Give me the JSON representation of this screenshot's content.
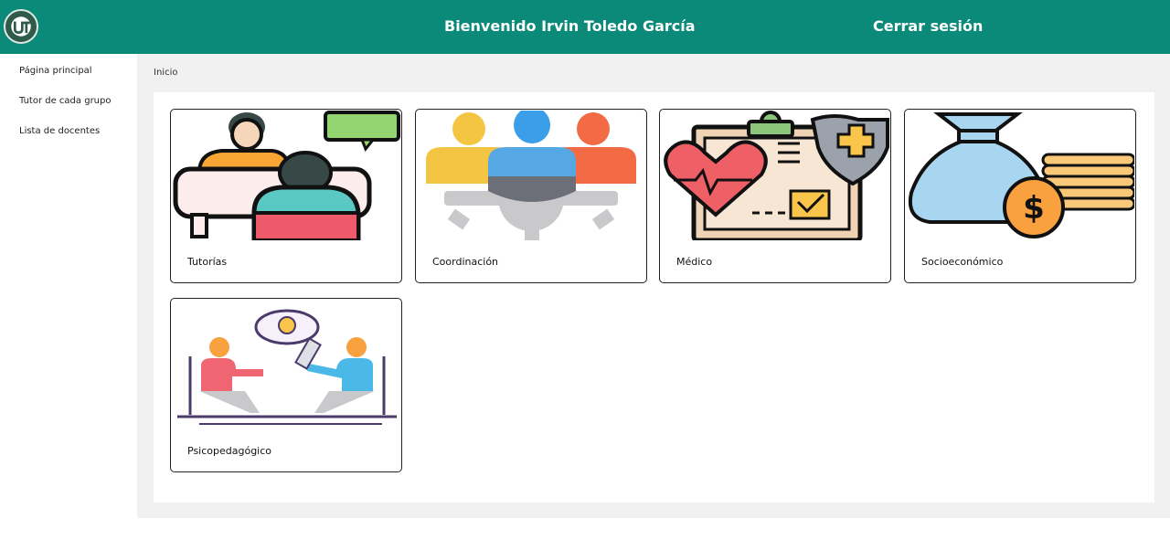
{
  "header": {
    "welcome": "Bienvenido Irvin Toledo García",
    "logout": "Cerrar sesión",
    "logo_icon": "ut-logo-icon",
    "colors": {
      "bar": "#0b8a79"
    }
  },
  "sidebar": {
    "items": [
      {
        "label": "Página principal"
      },
      {
        "label": "Tutor de cada grupo"
      },
      {
        "label": "Lista de docentes"
      }
    ]
  },
  "breadcrumb": "Inicio",
  "cards": [
    {
      "label": "Tutorías",
      "icon": "tutoring-icon"
    },
    {
      "label": "Coordinación",
      "icon": "coordination-team-gear-icon"
    },
    {
      "label": "Médico",
      "icon": "medical-clipboard-heart-icon"
    },
    {
      "label": "Socioeconómico",
      "icon": "money-bag-coins-icon"
    },
    {
      "label": "Psicopedagógico",
      "icon": "counseling-conversation-icon"
    }
  ]
}
